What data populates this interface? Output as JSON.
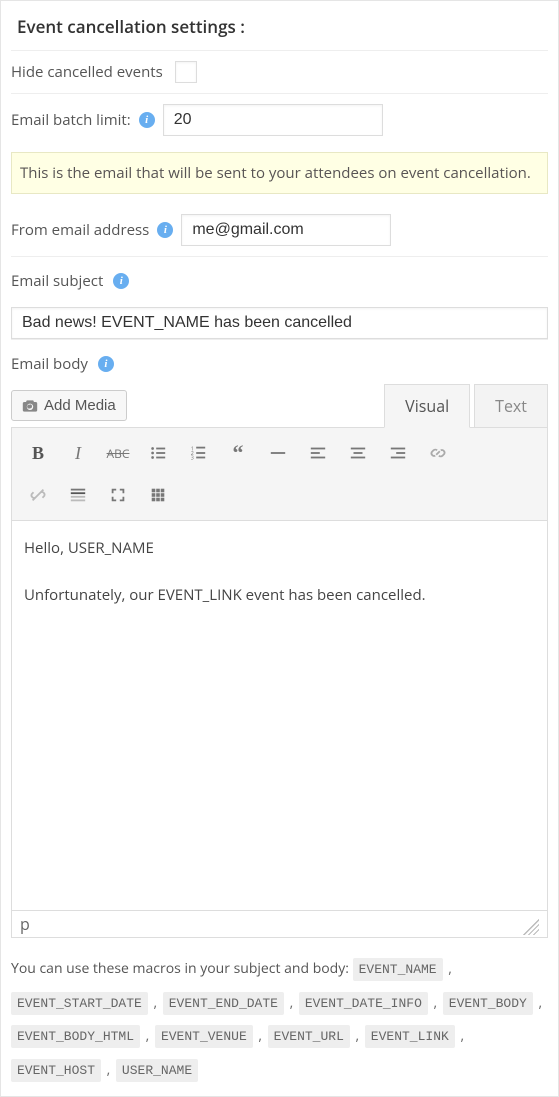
{
  "title": "Event cancellation settings :",
  "hide_label": "Hide cancelled events",
  "batch": {
    "label": "Email batch limit:",
    "value": "20"
  },
  "notice": "This is the email that will be sent to your attendees on event cancellation.",
  "from": {
    "label": "From email address",
    "value": "me@gmail.com"
  },
  "subject": {
    "label": "Email subject",
    "value": "Bad news! EVENT_NAME has been cancelled"
  },
  "body": {
    "label": "Email body",
    "add_media": "Add Media",
    "tab_visual": "Visual",
    "tab_text": "Text",
    "line1": "Hello, USER_NAME",
    "line2": "Unfortunately, our EVENT_LINK event has been cancelled.",
    "path": "p"
  },
  "macros": {
    "intro": "You can use these macros in your subject and body:",
    "list": [
      "EVENT_NAME",
      "EVENT_START_DATE",
      "EVENT_END_DATE",
      "EVENT_DATE_INFO",
      "EVENT_BODY",
      "EVENT_BODY_HTML",
      "EVENT_VENUE",
      "EVENT_URL",
      "EVENT_LINK",
      "EVENT_HOST",
      "USER_NAME"
    ]
  }
}
